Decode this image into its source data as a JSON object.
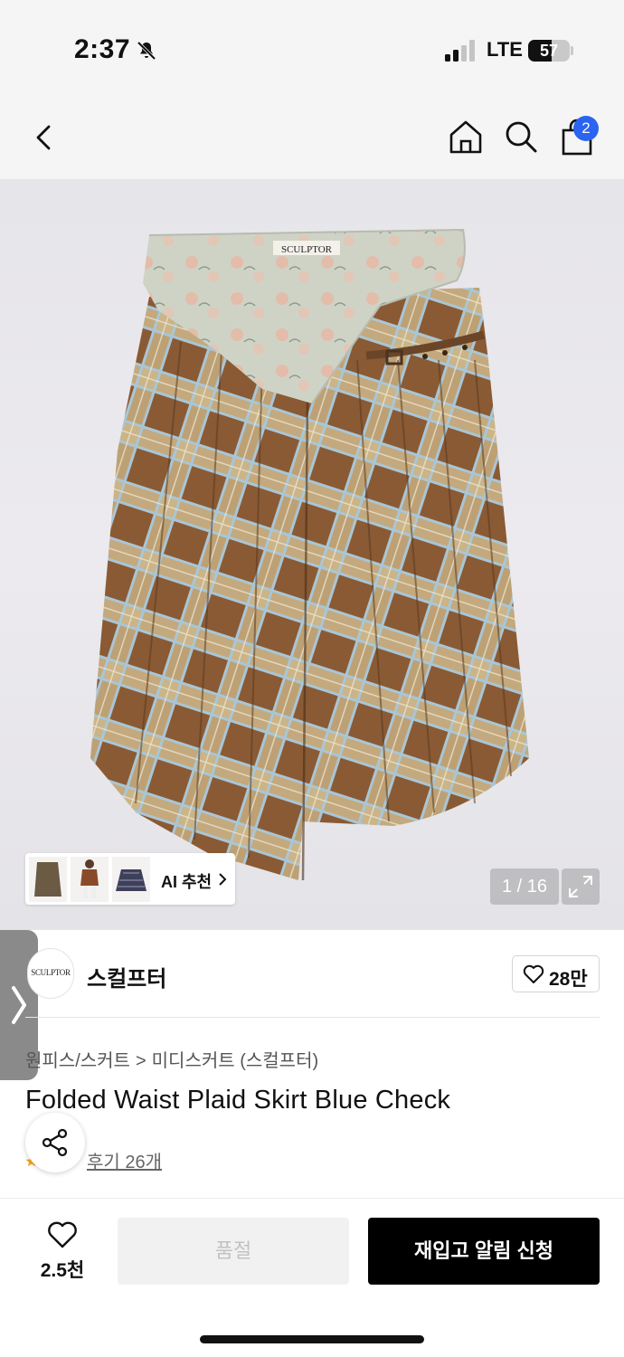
{
  "status_bar": {
    "time": "2:37",
    "network": "LTE",
    "battery": "57",
    "battery_level_percent": 57
  },
  "nav": {
    "cart_badge": "2",
    "icons": [
      "back-chevron-icon",
      "home-icon",
      "search-icon",
      "shopping-bag-icon"
    ]
  },
  "gallery": {
    "ai_recommend_label": "AI 추천",
    "counter": "1 / 16",
    "brand_tag_text": "SCULPTOR"
  },
  "brand": {
    "logo_text": "SCULPTOR",
    "name": "스컬프터",
    "likes": "28만"
  },
  "product": {
    "breadcrumb": [
      "원피스/스커트",
      "미디스커트 (스컬프터)"
    ],
    "title": "Folded Waist Plaid Skirt Blue Check",
    "reviews": "후기 26개"
  },
  "bottom_bar": {
    "wish_count": "2.5천",
    "soldout_label": "품절",
    "restock_label": "재입고 알림 신청"
  },
  "colors": {
    "accent_badge": "#2b64f0",
    "primary_button": "#000000",
    "disabled_button": "#f1f1f1",
    "plaid_brown": "#8a5a34",
    "plaid_tan": "#cdb88a",
    "plaid_blue": "#a9c6d6"
  }
}
